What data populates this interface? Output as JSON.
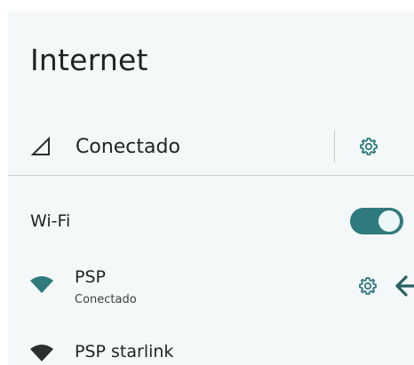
{
  "colors": {
    "accent": "#2f7a7d",
    "panel_background": "#f4f8f8",
    "text": "#1f2324",
    "connected_wifi_icon": "#2f7a7d",
    "other_wifi_icon": "#2b2f30"
  },
  "header": {
    "title": "Internet"
  },
  "mobile_network": {
    "icon": "cell-signal-icon",
    "status": "Conectado",
    "settings_icon": "gear-icon"
  },
  "wifi": {
    "label": "Wi-Fi",
    "enabled": true,
    "networks": [
      {
        "name": "PSP",
        "status": "Conectado",
        "icon": "wifi-icon",
        "settings_icon": "gear-icon",
        "annotation_icon": "arrow-left-icon"
      },
      {
        "name": "PSP starlink",
        "icon": "wifi-icon"
      }
    ]
  }
}
